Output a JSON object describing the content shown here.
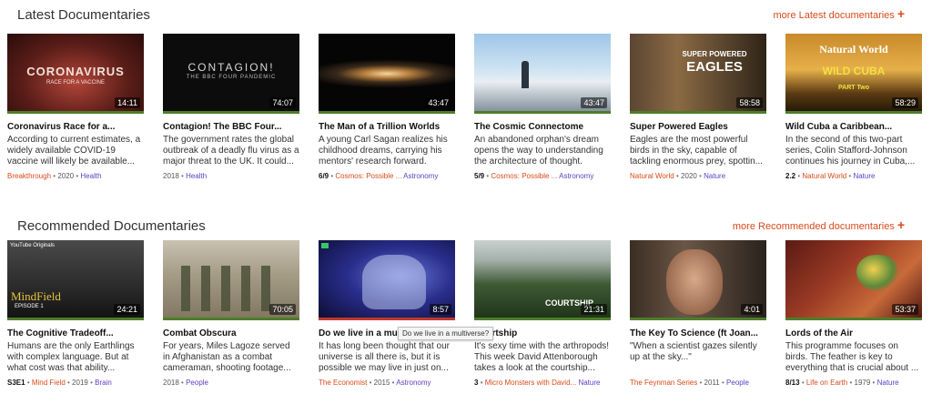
{
  "latest": {
    "title": "Latest Documentaries",
    "more_label": "more Latest documentaries",
    "cards": [
      {
        "title": "Coronavirus Race for a...",
        "description": "According to current estimates, a widely available COVID-19 vaccine will likely be available...",
        "duration": "14:11",
        "episode": "",
        "series": "Breakthrough",
        "year": "2020",
        "category": "Health",
        "thumb_text": "CORONAVIRUS",
        "thumb_sub": "RACE FOR A VACCINE"
      },
      {
        "title": "Contagion! The BBC Four...",
        "description": "The government rates the global outbreak of a deadly flu virus as a major threat to the UK. It could...",
        "duration": "74:07",
        "episode": "",
        "series": "",
        "year": "2018",
        "category": "Health",
        "thumb_text": "CONTAGION!",
        "thumb_sub": "THE BBC FOUR PANDEMIC"
      },
      {
        "title": "The Man of a Trillion Worlds",
        "description": "A young Carl Sagan realizes his childhood dreams, carrying his mentors' research forward.",
        "duration": "43:47",
        "episode": "6/9",
        "series": "Cosmos: Possible ...",
        "year": "",
        "category": "Astronomy",
        "thumb_text": "",
        "thumb_sub": ""
      },
      {
        "title": "The Cosmic Connectome",
        "description": "An abandoned orphan's dream opens the way to understanding the architecture of thought.",
        "duration": "43:47",
        "episode": "5/9",
        "series": "Cosmos: Possible ...",
        "year": "",
        "category": "Astronomy",
        "thumb_text": "",
        "thumb_sub": ""
      },
      {
        "title": "Super Powered Eagles",
        "description": "Eagles are the most powerful birds in the sky, capable of tackling enormous prey, spottin...",
        "duration": "58:58",
        "episode": "",
        "series": "Natural World",
        "year": "2020",
        "category": "Nature",
        "thumb_text": "SUPER POWERED",
        "thumb_sub": "EAGLES"
      },
      {
        "title": "Wild Cuba a Caribbean...",
        "description": "In the second of this two-part series, Colin Stafford-Johnson continues his journey in Cuba,...",
        "duration": "58:29",
        "episode": "2.2",
        "series": "Natural World",
        "year": "",
        "category": "Nature",
        "thumb_text": "Natural World",
        "thumb_sub": "WILD CUBA",
        "thumb_sub2": "PART Two"
      }
    ]
  },
  "recommended": {
    "title": "Recommended Documentaries",
    "more_label": "more Recommended documentaries",
    "cards": [
      {
        "title": "The Cognitive Tradeoff...",
        "description": "Humans are the only Earthlings with complex language. But at what cost was that ability...",
        "duration": "24:21",
        "episode": "S3E1",
        "series": "Mind Field",
        "year": "2019",
        "category": "Brain",
        "thumb_text": "MindField",
        "thumb_sub": "EPISODE 1",
        "thumb_top": "YouTube Originals"
      },
      {
        "title": "Combat Obscura",
        "description": "For years, Miles Lagoze served in Afghanistan as a combat cameraman, shooting footage...",
        "duration": "70:05",
        "episode": "",
        "series": "",
        "year": "2018",
        "category": "People",
        "thumb_text": "",
        "thumb_sub": ""
      },
      {
        "title": "Do we live in a multiverse?",
        "description": "It has long been thought that our universe is all there is, but it is possible we may live in just on...",
        "duration": "8:57",
        "episode": "",
        "series": "The Economist",
        "year": "2015",
        "category": "Astronomy",
        "thumb_text": "",
        "thumb_sub": ""
      },
      {
        "title": "Courtship",
        "description": "It's sexy time with the arthropods! This week David Attenborough takes a look at the courtship...",
        "duration": "21:31",
        "episode": "3",
        "series": "Micro Monsters with David...",
        "year": "",
        "category": "Nature",
        "thumb_text": "COURTSHIP",
        "thumb_sub": ""
      },
      {
        "title": "The Key To Science (ft Joan...",
        "description": "\"When a scientist gazes silently up at the sky...\"",
        "duration": "4:01",
        "episode": "",
        "series": "The Feynman Series",
        "year": "2011",
        "category": "People",
        "thumb_text": "",
        "thumb_sub": ""
      },
      {
        "title": "Lords of the Air",
        "description": "This programme focuses on birds. The feather is key to everything that is crucial about ...",
        "duration": "53:37",
        "episode": "8/13",
        "series": "Life on Earth",
        "year": "1979",
        "category": "Nature",
        "thumb_text": "",
        "thumb_sub": ""
      }
    ]
  },
  "tooltip": "Do we live in a multiverse?"
}
